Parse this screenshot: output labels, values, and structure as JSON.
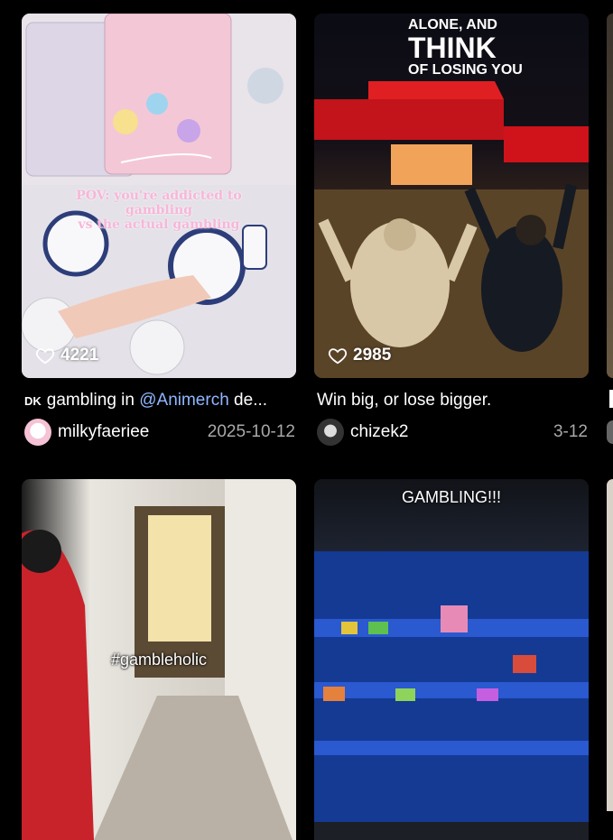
{
  "colors": {
    "background": "#000000",
    "mention": "#8fb7ff",
    "date": "#a8a8a8"
  },
  "cards": [
    {
      "likes": "4221",
      "overlay": [
        "POV: you're addicted to gambling",
        "vs the actual gambling"
      ],
      "caption_prefix": "DK",
      "caption_text": "gambling in ",
      "caption_mention": "@Animerch",
      "caption_rest": " de...",
      "author": "milkyfaeriee",
      "date": "2025-10-12"
    },
    {
      "likes": "2985",
      "overlay": [
        "ALONE, AND",
        "THINK",
        "OF LOSING YOU"
      ],
      "caption_text": "Win big, or lose bigger.",
      "author": "chizek2",
      "date": "3-12"
    },
    {
      "overlay": [
        "#gambleholic"
      ]
    },
    {
      "overlay": [
        "GAMBLING!!!"
      ]
    }
  ]
}
